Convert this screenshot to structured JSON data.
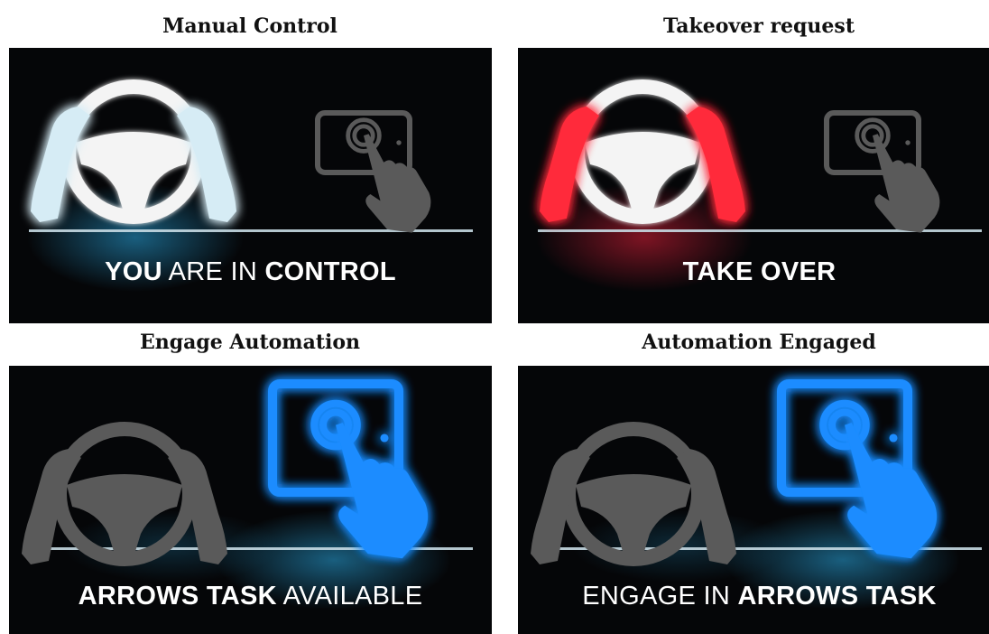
{
  "colors": {
    "panel_bg": "#050608",
    "glow_blue": "#2aa7e0",
    "glow_red": "#e0203a",
    "active_blue": "#1a8cff",
    "hands_ice": "#d6ecf5",
    "hands_red": "#ff2a3a",
    "dim_gray": "#5a5a5a",
    "wheel_white": "#f4f4f4",
    "divider": "#c8dbe4"
  },
  "panels": [
    {
      "title": "Manual Control",
      "caption": [
        {
          "text": "YOU",
          "bold": true
        },
        {
          "text": " ARE IN ",
          "bold": false
        },
        {
          "text": "CONTROL",
          "bold": true
        }
      ],
      "wheel_state": "active",
      "hands_color": "ice",
      "tablet_state": "dim",
      "glow": "blue",
      "icons": [
        "steering-wheel-icon",
        "hands-on-wheel-icon",
        "tablet-touch-icon"
      ]
    },
    {
      "title": "Takeover request",
      "caption": [
        {
          "text": "TAKE OVER",
          "bold": true
        }
      ],
      "wheel_state": "active",
      "hands_color": "red",
      "tablet_state": "dim",
      "glow": "red",
      "icons": [
        "steering-wheel-icon",
        "hands-on-wheel-icon",
        "tablet-touch-icon"
      ]
    },
    {
      "title": "Engage Automation",
      "caption": [
        {
          "text": "ARROWS TASK",
          "bold": true
        },
        {
          "text": " AVAILABLE",
          "bold": false
        }
      ],
      "wheel_state": "dim",
      "hands_color": "dim",
      "tablet_state": "active",
      "glow": "blue",
      "icons": [
        "steering-wheel-icon",
        "hands-on-wheel-icon",
        "tablet-touch-icon"
      ]
    },
    {
      "title": "Automation Engaged",
      "caption": [
        {
          "text": "ENGAGE IN ",
          "bold": false
        },
        {
          "text": "ARROWS TASK",
          "bold": true
        }
      ],
      "wheel_state": "dim",
      "hands_color": "dim",
      "tablet_state": "active",
      "glow": "blue",
      "icons": [
        "steering-wheel-icon",
        "hands-on-wheel-icon",
        "tablet-touch-icon"
      ]
    }
  ]
}
